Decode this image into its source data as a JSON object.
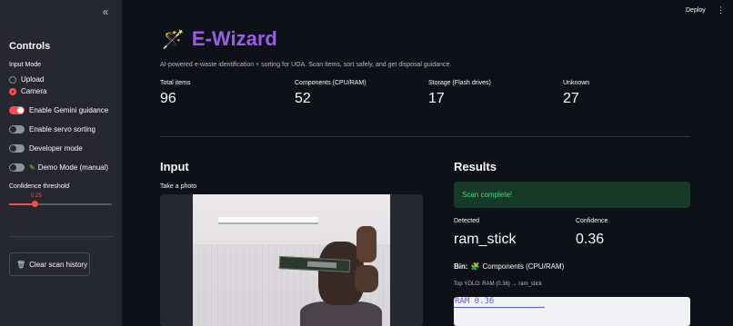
{
  "sidebar": {
    "collapse_icon": "«",
    "title": "Controls",
    "input_mode_label": "Input Mode",
    "input_options": [
      {
        "label": "Upload",
        "selected": false
      },
      {
        "label": "Camera",
        "selected": true
      }
    ],
    "toggles": [
      {
        "label": "Enable Gemini guidance",
        "on": true
      },
      {
        "label": "Enable servo sorting",
        "on": false
      },
      {
        "label": "Developer mode",
        "on": false
      },
      {
        "label": "Demo Mode (manual)",
        "on": false,
        "icon": "pencil-icon"
      }
    ],
    "confidence": {
      "label": "Confidence threshold",
      "value_text": "0.25",
      "value": 0.25
    },
    "clear_button": "Clear scan history"
  },
  "header": {
    "deploy_label": "Deploy",
    "menu_icon": "⋮"
  },
  "main": {
    "title": "E-Wizard",
    "title_icon": "wand-icon",
    "subtitle": "AI-powered e-waste identification + sorting for UGA. Scan items, sort safely, and get disposal guidance.",
    "metrics": [
      {
        "label": "Total items",
        "value": "96"
      },
      {
        "label": "Components (CPU/RAM)",
        "value": "52"
      },
      {
        "label": "Storage (Flash drives)",
        "value": "17"
      },
      {
        "label": "Unknown",
        "value": "27"
      }
    ],
    "input": {
      "heading": "Input",
      "camera_label": "Take a photo"
    },
    "results": {
      "heading": "Results",
      "status": "Scan complete!",
      "detected_label": "Detected",
      "detected_value": "ram_stick",
      "confidence_label": "Confidence",
      "confidence_value": "0.36",
      "bin_prefix": "Bin:",
      "bin_value": "Components (CPU/RAM)",
      "yolo_line": "Top YOLO: RAM (0.36) → ram_stick",
      "annotation_tag": "RAM 0.36"
    }
  },
  "colors": {
    "accent": "#ff4b4b",
    "title": "#9b5de5",
    "success_bg": "#173928",
    "success_text": "#4fd47e",
    "background": "#0e1117",
    "sidebar": "#262730"
  }
}
